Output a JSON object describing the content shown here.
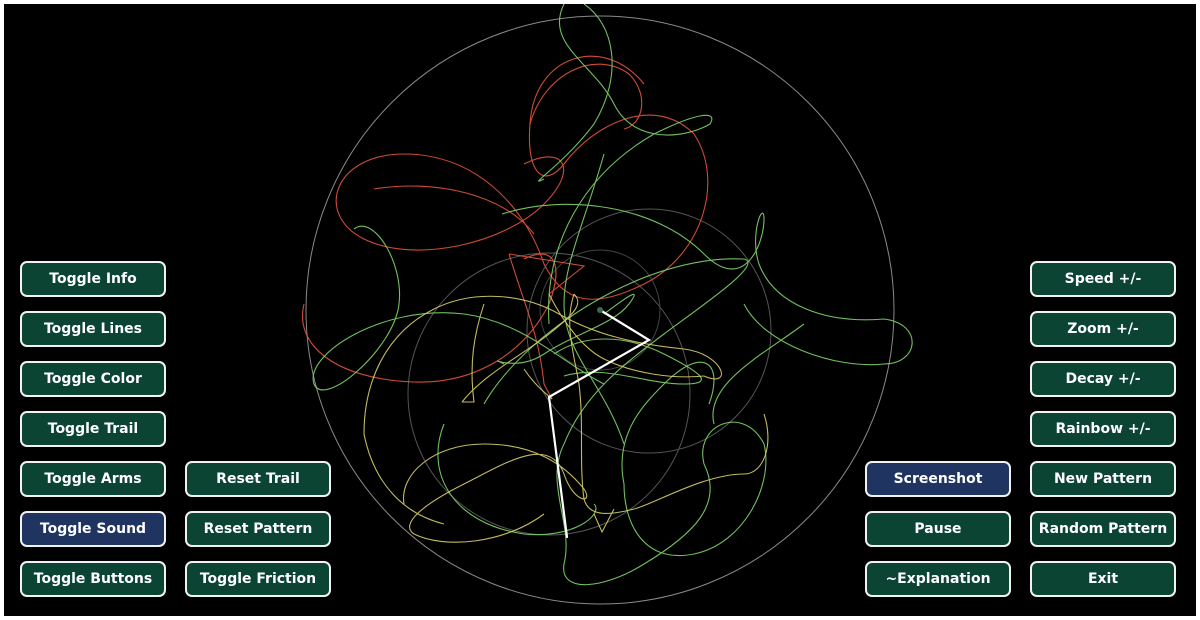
{
  "left_buttons": [
    {
      "label": "Toggle Info",
      "active": false
    },
    {
      "label": "Toggle Lines",
      "active": false
    },
    {
      "label": "Toggle Color",
      "active": false
    },
    {
      "label": "Toggle Trail",
      "active": false
    },
    {
      "label": "Toggle Arms",
      "active": false
    },
    {
      "label": "Toggle Sound",
      "active": true
    },
    {
      "label": "Toggle Buttons",
      "active": false
    }
  ],
  "left_secondary_buttons": [
    {
      "label": "Reset Trail",
      "active": false
    },
    {
      "label": "Reset Pattern",
      "active": false
    },
    {
      "label": "Toggle Friction",
      "active": false
    }
  ],
  "right_secondary_buttons": [
    {
      "label": "Screenshot",
      "active": true
    },
    {
      "label": "Pause",
      "active": false
    },
    {
      "label": "~Explanation",
      "active": false
    }
  ],
  "right_buttons": [
    {
      "label": "Speed +/-",
      "active": false
    },
    {
      "label": "Zoom +/-",
      "active": false
    },
    {
      "label": "Decay +/-",
      "active": false
    },
    {
      "label": "Rainbow +/-",
      "active": false
    },
    {
      "label": "New Pattern",
      "active": false
    },
    {
      "label": "Random Pattern",
      "active": false
    },
    {
      "label": "Exit",
      "active": false
    }
  ],
  "colors": {
    "background": "#000000",
    "button_fill": "#0b4433",
    "button_active_fill": "#1f3461",
    "button_border": "#f2f2f2",
    "guide_circle": "#8a8a8a",
    "arm": "#ffffff",
    "trail_red": "#e5553c",
    "trail_green": "#7fd46a",
    "trail_yellow": "#d8cf6a"
  }
}
